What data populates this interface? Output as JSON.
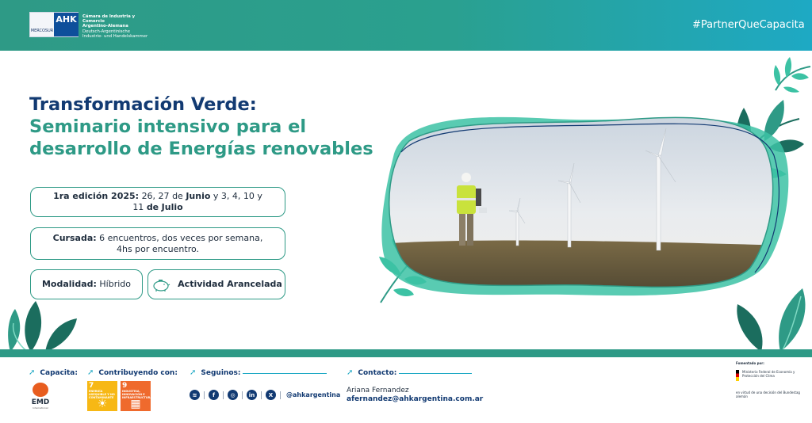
{
  "header": {
    "logo_left_text": "MERCOSUR",
    "logo_right_text": "AHK",
    "chamber_name_line1": "Cámara de Industria y Comercio",
    "chamber_name_line2": "Argentino-Alemana",
    "chamber_name_line3": "Deutsch-Argentinische",
    "chamber_name_line4": "Industrie- und Handelskammer",
    "hashtag": "#PartnerQueCapacita"
  },
  "title": {
    "line1": "Transformación Verde:",
    "line2": "Seminario intensivo para el",
    "line3": "desarrollo de Energías renovables"
  },
  "info": {
    "edicion_label": "1ra edición 2025:",
    "edicion_days1": "26, 27",
    "edicion_de1": "de",
    "edicion_month1": "Junio",
    "edicion_days2": "y 3, 4, 10 y 11",
    "edicion_de2": "de",
    "edicion_month2": "Julio",
    "cursada_label": "Cursada:",
    "cursada_text1": "6 encuentros, dos veces por semana,",
    "cursada_text2": "4hs por encuentro.",
    "modalidad_label": "Modalidad:",
    "modalidad_value": "Híbrido",
    "arancel_label": "Actividad Arancelada"
  },
  "footer": {
    "capacita_label": "Capacita:",
    "contribuyendo_label": "Contribuyendo con:",
    "seguinos_label": "Seguinos:",
    "contacto_label": "Contacto:",
    "emd_name": "EMD",
    "emd_sub": "International",
    "sdg7_num": "7",
    "sdg7_text": "ENERGÍA ASEQUIBLE Y NO CONTAMINANTE",
    "sdg9_num": "9",
    "sdg9_text": "INDUSTRIA, INNOVACIÓN E INFRAESTRUCTURA",
    "social_handle": "@ahkargentina",
    "contact_name": "Ariana Fernandez",
    "contact_email": "afernandez@ahkargentina.com.ar",
    "fomentado_label": "Fomentado por:",
    "ministry": "Ministerio Federal de Economía y Protección del Clima",
    "ministry_note": "en virtud de una decisión del Bundestag alemán"
  },
  "colors": {
    "teal": "#2e9a86",
    "navy": "#123a72",
    "cyan": "#1ea9c4",
    "sdg7": "#f7b815",
    "sdg9": "#ef6a2d"
  }
}
